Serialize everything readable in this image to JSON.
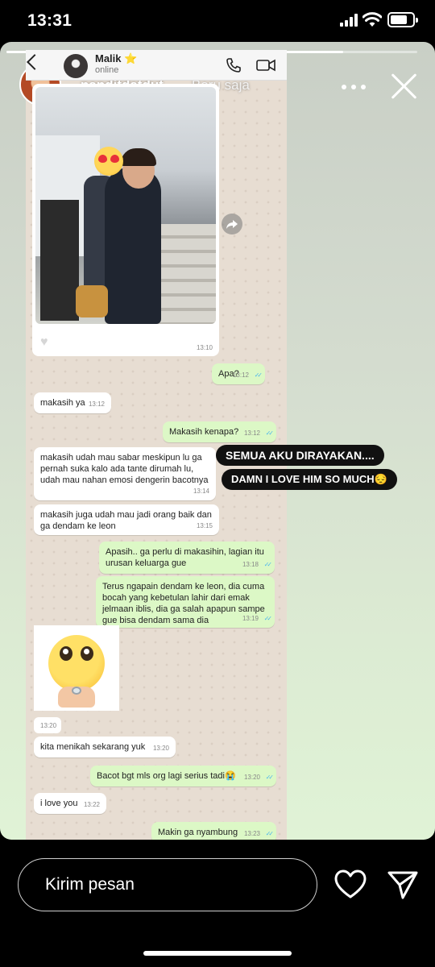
{
  "status_bar": {
    "time": "13:31"
  },
  "story": {
    "username": "nanditdatdut",
    "posted": "Baru saja",
    "progress": 0.82
  },
  "chat": {
    "contact_name": "Malik",
    "contact_status": "online",
    "photo_time": "13:10",
    "sticker_time": "13:20",
    "messages": [
      {
        "dir": "out",
        "text": "Apa?",
        "time": "13:12"
      },
      {
        "dir": "in",
        "text": "makasih ya",
        "time": "13:12"
      },
      {
        "dir": "out",
        "text": "Makasih kenapa?",
        "time": "13:12"
      },
      {
        "dir": "in",
        "text": "makasih udah mau sabar meskipun lu ga pernah suka kalo ada tante dirumah lu, udah mau nahan emosi dengerin bacotnya",
        "time": "13:14"
      },
      {
        "dir": "in",
        "text": "makasih juga udah mau jadi orang baik dan ga dendam ke leon",
        "time": "13:15"
      },
      {
        "dir": "out",
        "text": "Apasih.. ga perlu di makasihin, lagian itu urusan keluarga gue",
        "time": "13:18"
      },
      {
        "dir": "out",
        "text": "Terus ngapain dendam ke leon, dia cuma bocah yang kebetulan lahir dari emak jelmaan iblis, dia ga salah apapun sampe gue bisa dendam sama dia",
        "time": "13:19"
      },
      {
        "dir": "in",
        "text": "kita menikah sekarang yuk",
        "time": "13:20"
      },
      {
        "dir": "out",
        "text": "Bacot bgt mls org lagi serius tadi😭",
        "time": "13:20"
      },
      {
        "dir": "in",
        "text": "i love you",
        "time": "13:22"
      },
      {
        "dir": "out",
        "text": "Makin ga nyambung",
        "time": "13:23"
      }
    ]
  },
  "captions": [
    "SEMUA AKU DIRAYAKAN....",
    "DAMN I LOVE HIM SO MUCH😔"
  ],
  "reply": {
    "placeholder": "Kirim pesan"
  },
  "icons": {
    "status": [
      "signal-icon",
      "wifi-icon",
      "battery-icon"
    ],
    "story": [
      "more-icon",
      "close-icon",
      "heart-icon",
      "send-icon"
    ],
    "chat": [
      "back-icon",
      "phone-icon",
      "video-icon",
      "forward-icon"
    ]
  }
}
